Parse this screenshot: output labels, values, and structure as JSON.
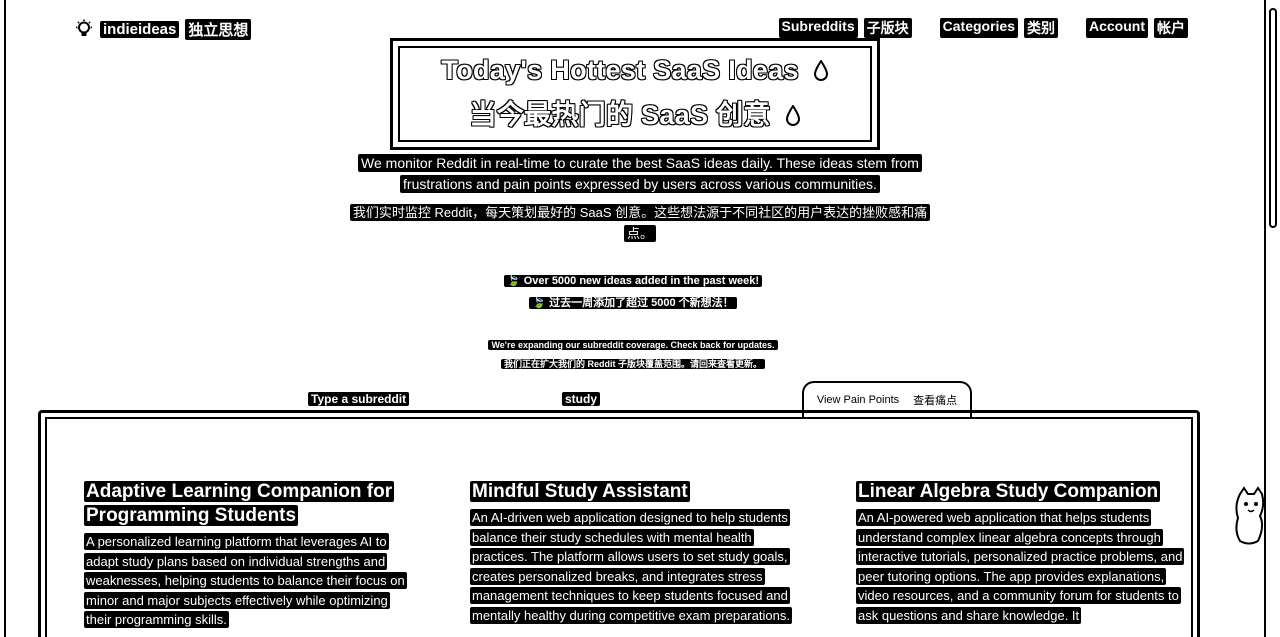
{
  "header": {
    "logo_text": "indieideas",
    "logo_subtitle": "独立思想",
    "nav": [
      {
        "label": "Subreddits",
        "label_zh": "子版块"
      },
      {
        "label": "Categories",
        "label_zh": "类别"
      },
      {
        "label": "Account",
        "label_zh": "帐户"
      }
    ]
  },
  "hero": {
    "title_en": "Today's Hottest SaaS Ideas",
    "title_zh": "当今最热门的 SaaS 创意",
    "desc_en": "We monitor Reddit in real-time to curate the best SaaS ideas daily. These ideas stem from frustrations and pain points expressed by users across various communities.",
    "desc_zh": "我们实时监控 Reddit，每天策划最好的 SaaS 创意。这些想法源于不同社区的用户表达的挫败感和痛点。",
    "stat_en": "Over 5000 new ideas added in the past week!",
    "stat_zh": "过去一周添加了超过 5000 个新想法！",
    "notice_en": "We're expanding our subreddit coverage. Check back for updates.",
    "notice_zh": "我们正在扩大我们的 Reddit 子版块覆盖范围。请回来查看更新。"
  },
  "search": {
    "placeholder": "Type a subreddit",
    "value": "study",
    "button_label": "View Pain Points",
    "button_label_zh": "查看痛点"
  },
  "cards": [
    {
      "title": "Adaptive Learning Companion for Programming Students",
      "description": "A personalized learning platform that leverages AI to adapt study plans based on individual strengths and weaknesses, helping students to balance their focus on minor and major subjects effectively while optimizing their programming skills."
    },
    {
      "title": "Mindful Study Assistant",
      "description": "An AI-driven web application designed to help students balance their study schedules with mental health practices. The platform allows users to set study goals, creates personalized breaks, and integrates stress management techniques to keep students focused and mentally healthy during competitive exam preparations."
    },
    {
      "title": "Linear Algebra Study Companion",
      "description": "An AI-powered web application that helps students understand complex linear algebra concepts through interactive tutorials, personalized practice problems, and peer tutoring options. The app provides explanations, video resources, and a community forum for students to ask questions and share knowledge. It"
    }
  ]
}
